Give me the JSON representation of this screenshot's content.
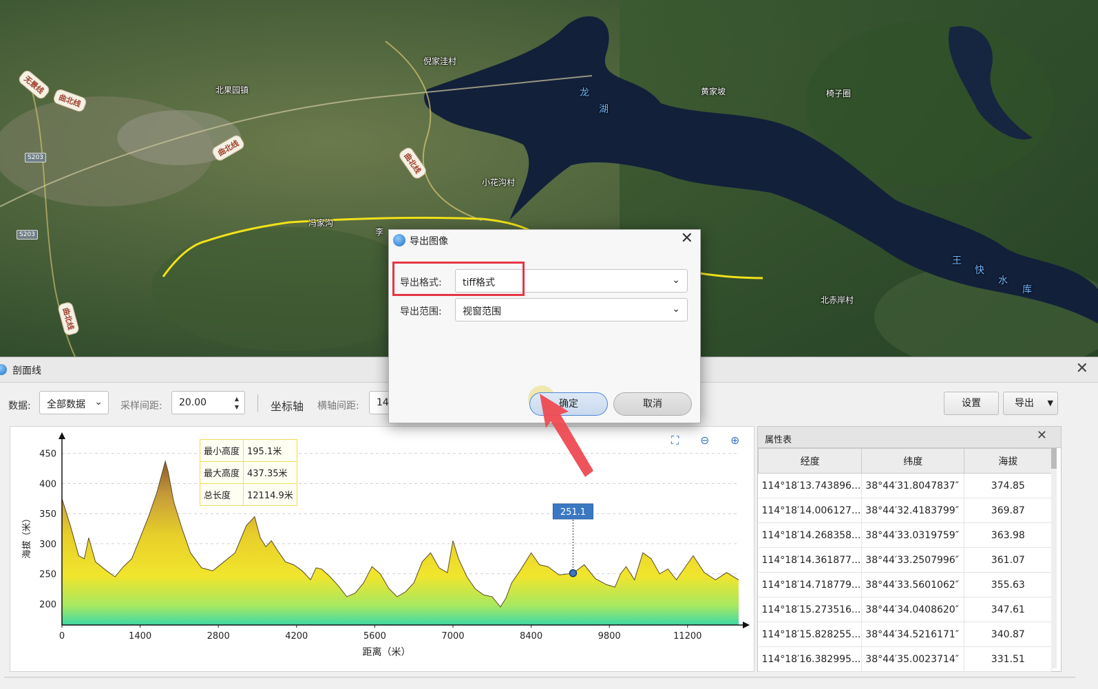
{
  "map": {
    "labels": [
      "倪家洼村",
      "北果园镇",
      "黄家坡",
      "椅子圈",
      "小花沟村",
      "冯家沟",
      "李",
      "北赤岸村"
    ],
    "road_tags": [
      "无景线",
      "曲北线",
      "曲北线",
      "曲北线",
      "曲北线"
    ],
    "shields": [
      "S203",
      "S203"
    ],
    "water_names": [
      "王",
      "快",
      "水",
      "库",
      "龙",
      "湖"
    ]
  },
  "panel": {
    "title": "剖面线",
    "toolbar": {
      "data_label": "数据:",
      "data_value": "全部数据",
      "interval_label": "采样间距:",
      "interval_value": "20.00",
      "axis_label": "坐标轴",
      "h_axis_label": "横轴间距:",
      "h_axis_value": "14",
      "settings_button": "设置",
      "export_button": "导出"
    },
    "stats": {
      "min_label": "最小高度",
      "min_value": "195.1米",
      "max_label": "最大高度",
      "max_value": "437.35米",
      "len_label": "总长度",
      "len_value": "12114.9米"
    },
    "marker_value": "251.1",
    "attr_table": {
      "title": "属性表",
      "headers": [
        "经度",
        "纬度",
        "海拔"
      ],
      "rows": [
        [
          "114°18′13.743896...",
          "38°44′31.8047837″",
          "374.85"
        ],
        [
          "114°18′14.006127...",
          "38°44′32.4183799″",
          "369.87"
        ],
        [
          "114°18′14.268358...",
          "38°44′33.0319759″",
          "363.98"
        ],
        [
          "114°18′14.361877...",
          "38°44′33.2507996″",
          "361.07"
        ],
        [
          "114°18′14.718779...",
          "38°44′33.5601062″",
          "355.63"
        ],
        [
          "114°18′15.273516...",
          "38°44′34.0408620″",
          "347.61"
        ],
        [
          "114°18′15.828255...",
          "38°44′34.5216171″",
          "340.87"
        ],
        [
          "114°18′16.382995...",
          "38°44′35.0023714″",
          "331.51"
        ]
      ]
    }
  },
  "dialog": {
    "title": "导出图像",
    "format_label": "导出格式:",
    "format_value": "tiff格式",
    "range_label": "导出范围:",
    "range_value": "视窗范围",
    "ok_button": "确定",
    "cancel_button": "取消"
  },
  "colors": {
    "route_line": "#f2e21a",
    "highlight": "#e53544",
    "marker": "#3a78c2"
  },
  "chart_data": {
    "type": "area",
    "xlabel": "距离（米）",
    "ylabel": "海拔（米）",
    "xlim": [
      0,
      12114.9
    ],
    "ylim": [
      165,
      460
    ],
    "xticks": [
      0,
      1400,
      2800,
      4200,
      5600,
      7000,
      8400,
      9800,
      11200
    ],
    "yticks": [
      200,
      250,
      300,
      350,
      400,
      450
    ],
    "marker": {
      "x": 9150,
      "y": 251.1,
      "label": "251.1"
    },
    "x": [
      0,
      150,
      300,
      400,
      480,
      600,
      800,
      950,
      1100,
      1250,
      1400,
      1550,
      1700,
      1800,
      1850,
      1900,
      2000,
      2150,
      2300,
      2500,
      2700,
      2900,
      3100,
      3300,
      3450,
      3550,
      3650,
      3750,
      3850,
      4000,
      4150,
      4300,
      4450,
      4550,
      4650,
      4800,
      4950,
      5100,
      5250,
      5400,
      5550,
      5700,
      5850,
      6000,
      6150,
      6300,
      6450,
      6600,
      6750,
      6900,
      7000,
      7100,
      7250,
      7400,
      7550,
      7700,
      7850,
      7950,
      8050,
      8200,
      8400,
      8550,
      8700,
      8900,
      9150,
      9350,
      9550,
      9750,
      9900,
      10000,
      10100,
      10250,
      10400,
      10550,
      10700,
      10850,
      11000,
      11150,
      11300,
      11500,
      11700,
      11900,
      12114.9
    ],
    "y": [
      375,
      330,
      280,
      275,
      310,
      270,
      255,
      245,
      262,
      275,
      310,
      345,
      385,
      420,
      437,
      420,
      370,
      325,
      285,
      260,
      255,
      270,
      285,
      330,
      345,
      310,
      295,
      305,
      290,
      270,
      265,
      255,
      240,
      260,
      258,
      245,
      230,
      212,
      218,
      235,
      262,
      250,
      226,
      212,
      220,
      235,
      270,
      285,
      260,
      252,
      305,
      275,
      245,
      225,
      215,
      212,
      195,
      210,
      235,
      255,
      285,
      265,
      262,
      248,
      251,
      265,
      242,
      232,
      228,
      250,
      262,
      240,
      285,
      275,
      250,
      258,
      240,
      260,
      280,
      252,
      240,
      252,
      240
    ]
  }
}
